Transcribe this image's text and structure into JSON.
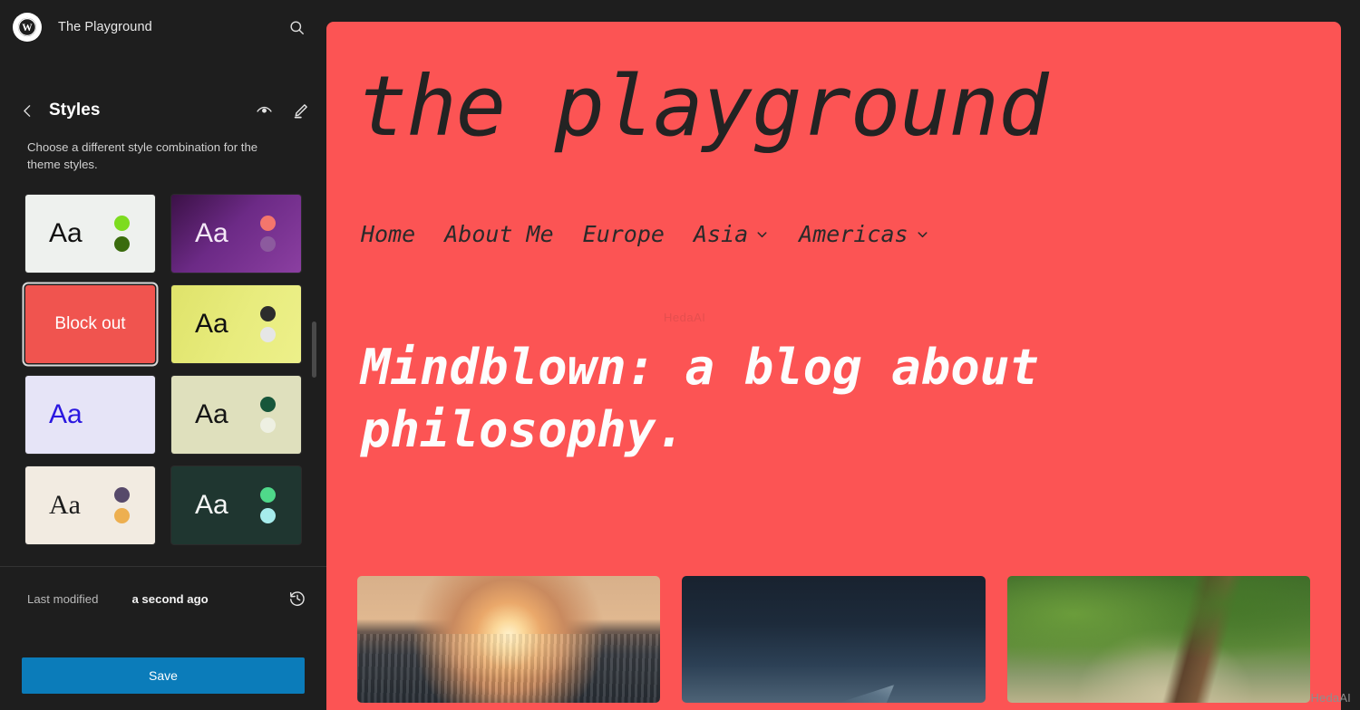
{
  "sidebar": {
    "logo_icon": "wordpress-logo-icon",
    "site_title": "The Playground",
    "search_icon": "search-icon",
    "back_icon": "chevron-left-icon",
    "panel_title": "Styles",
    "preview_icon": "eye-icon",
    "edit_icon": "pencil-icon",
    "description": "Choose a different style combination for the theme styles.",
    "swatches": [
      {
        "name": "light-green",
        "label": "Aa",
        "kind": "aa",
        "bg": "#eef1ee",
        "text": "#111111",
        "serif": false,
        "dots": [
          "#7ddc1f",
          "#3a6b0d"
        ]
      },
      {
        "name": "purple-gradient",
        "label": "Aa",
        "kind": "aa",
        "bg": "linear-gradient(135deg,#3b1146 0%,#6c2a86 45%,#8b3fa1 100%)",
        "text": "#f4e7f7",
        "serif": false,
        "dots": [
          "#f4766c",
          "#8c5a9e"
        ]
      },
      {
        "name": "block-out",
        "label": "Block out",
        "kind": "label",
        "bg": "#f0544f",
        "text": "#ffffff",
        "serif": false,
        "dots": [],
        "selected": true
      },
      {
        "name": "yellow-lime",
        "label": "Aa",
        "kind": "aa",
        "bg": "linear-gradient(115deg,#dfe36a 0%,#e8ec7e 55%,#edf08a 100%)",
        "text": "#101010",
        "serif": false,
        "dots": [
          "#2c2c2c",
          "#e6e6e6"
        ]
      },
      {
        "name": "lavender-blue",
        "label": "Aa",
        "kind": "aa",
        "bg": "#e6e4f7",
        "text": "#2a17e0",
        "serif": false,
        "dots": []
      },
      {
        "name": "sage-green",
        "label": "Aa",
        "kind": "aa",
        "bg": "#dfe0bd",
        "text": "#151515",
        "serif": false,
        "dots": [
          "#17563a",
          "#eef0e2"
        ]
      },
      {
        "name": "cream-serif",
        "label": "Aa",
        "kind": "aa",
        "bg": "#f2ebe1",
        "text": "#1c1c1c",
        "serif": true,
        "dots": [
          "#57496a",
          "#edaf50"
        ]
      },
      {
        "name": "dark-teal",
        "label": "Aa",
        "kind": "aa",
        "bg": "#1f3630",
        "text": "#f5f7f6",
        "serif": false,
        "dots": [
          "#4fd98a",
          "#a6ecec"
        ]
      }
    ],
    "last_modified_label": "Last modified",
    "last_modified_value": "a second ago",
    "history_icon": "revision-history-icon",
    "save_label": "Save"
  },
  "preview": {
    "brand_color": "#fc5454",
    "site_title": "the playground",
    "nav": [
      {
        "label": "Home",
        "has_dropdown": false
      },
      {
        "label": "About Me",
        "has_dropdown": false
      },
      {
        "label": "Europe",
        "has_dropdown": false
      },
      {
        "label": "Asia",
        "has_dropdown": true
      },
      {
        "label": "Americas",
        "has_dropdown": true
      }
    ],
    "caret_icon": "chevron-down-icon",
    "headline": "Mindblown: a blog about philosophy.",
    "faint_watermark": "HedaAI",
    "thumbnails": [
      {
        "name": "thumb-sunset-over-water"
      },
      {
        "name": "thumb-night-sky"
      },
      {
        "name": "thumb-forest-path"
      }
    ]
  },
  "watermark": "HedaAI"
}
